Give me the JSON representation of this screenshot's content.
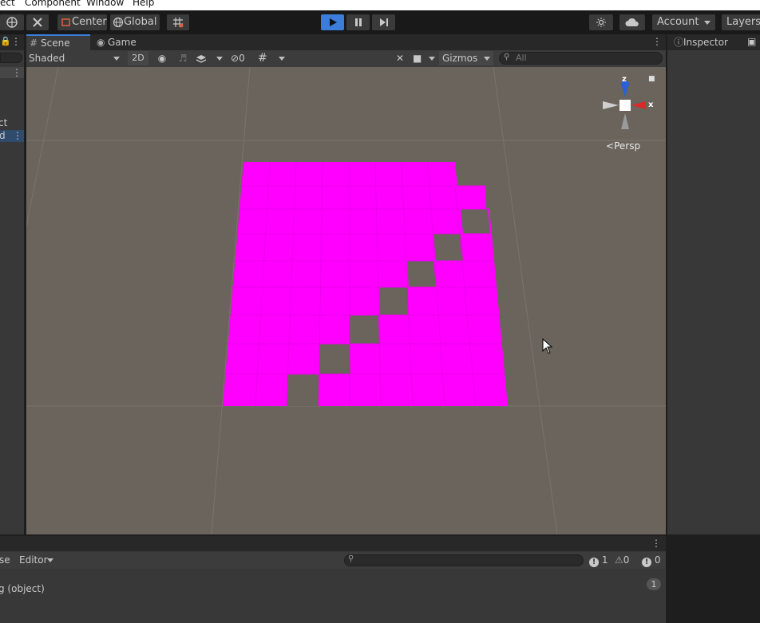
{
  "menu": {
    "items": [
      "ect",
      "Component",
      "Window",
      "Help"
    ]
  },
  "toolbar": {
    "pivot_label": "Center",
    "space_label": "Global",
    "account_label": "Account",
    "layers_label": "Layers"
  },
  "scene_panel": {
    "tabs": [
      {
        "label": "Scene",
        "icon": "grid-icon"
      },
      {
        "label": "Game",
        "icon": "gamepad-icon"
      }
    ],
    "shading_mode": "Shaded",
    "mode_2d": "2D",
    "hidden_count": "0",
    "gizmos_label": "Gizmos",
    "search_placeholder": "All",
    "gizmo": {
      "axis_z": "z",
      "axis_x": "x",
      "projection": "Persp"
    }
  },
  "inspector": {
    "tab_label": "Inspector"
  },
  "hierarchy": {
    "fragments": [
      "ct",
      "d"
    ]
  },
  "console": {
    "left_fragment": "se",
    "editor_label": "Editor",
    "message_count": "1",
    "warning_count": "0",
    "error_count": "0",
    "log_text": "g (object)",
    "log_collapse_count": "1"
  },
  "colors": {
    "magenta": "#ff00ff",
    "scene_bg": "#6b645c",
    "play_active": "#3b7dd8"
  }
}
